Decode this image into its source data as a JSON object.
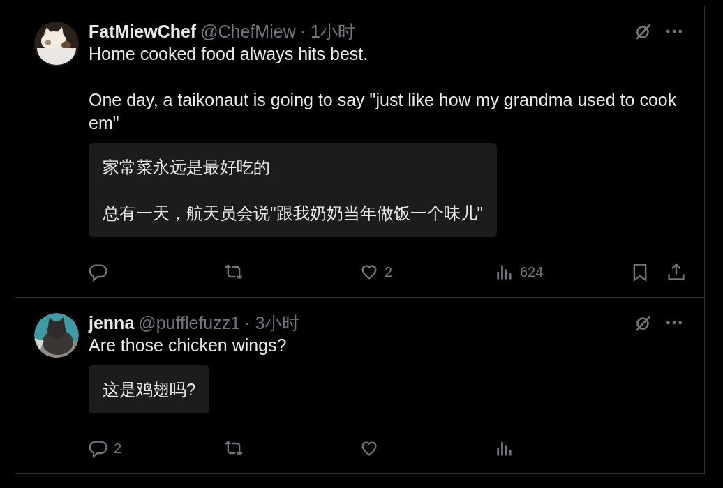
{
  "tweets": [
    {
      "name": "FatMiewChef",
      "handle": "@ChefMiew",
      "time": "· 1小时",
      "avatar": {
        "kind": "picture"
      },
      "text": [
        "Home cooked food always hits best.",
        "One day, a taikonaut is going to say \"just like how my grandma used to cook em\""
      ],
      "translation": [
        "家常菜永远是最好吃的",
        "总有一天，航天员会说\"跟我奶奶当年做饭一个味儿\""
      ],
      "actions": [
        {
          "kind": "reply"
        },
        {
          "kind": "repost"
        },
        {
          "kind": "like",
          "count": "2"
        },
        {
          "kind": "views",
          "count": "624"
        },
        {
          "kind": "bookmark"
        },
        {
          "kind": "share"
        }
      ]
    },
    {
      "name": "jenna",
      "handle": "@pufflefuzz1",
      "time": "· 3小时",
      "avatar": {
        "kind": "picture"
      },
      "text": [
        "Are those chicken wings?"
      ],
      "translation": [
        "这是鸡翅吗?"
      ],
      "actions": [
        {
          "kind": "reply",
          "count": "2"
        },
        {
          "kind": "repost"
        },
        {
          "kind": "like"
        },
        {
          "kind": "views"
        }
      ]
    }
  ]
}
